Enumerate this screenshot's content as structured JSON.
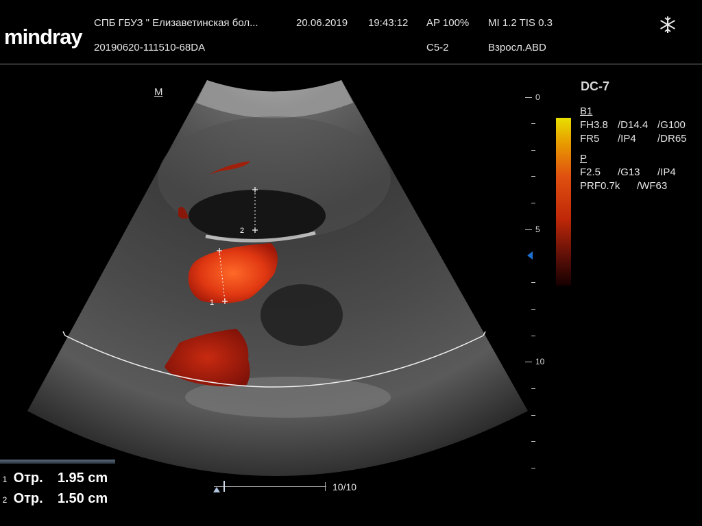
{
  "header": {
    "logo": "mindray",
    "institution": "СПБ  ГБУЗ \" Елизаветинская бол...",
    "date": "20.06.2019",
    "time": "19:43:12",
    "ap": "AP  100%",
    "mi_tis": "MI 1.2 TIS 0.3",
    "patient_id": "20190620-111510-68DA",
    "probe": "C5-2",
    "preset": "Взросл.ABD",
    "freeze_icon": "snowflake-icon"
  },
  "image": {
    "orientation_marker": "M",
    "page": "10/10"
  },
  "depth_scale": {
    "labels": [
      "0",
      "5",
      "10"
    ]
  },
  "params": {
    "system": "DC-7",
    "b_mode_title": "B1",
    "b_line1": [
      "FH3.8",
      "/D14.4",
      "/G100"
    ],
    "b_line2": [
      "FR5",
      "/IP4",
      "/DR65"
    ],
    "p_mode_title": "P",
    "p_line1": [
      "F2.5",
      "/G13",
      "/IP4"
    ],
    "p_line2": [
      "PRF0.7k",
      "/WF63"
    ]
  },
  "colors": {
    "doppler_top": "#e8e000",
    "doppler_mid": "#d03010",
    "doppler_bottom": "#200000",
    "focus_marker": "#1e70d0"
  },
  "measurements": [
    {
      "index": "1",
      "label": "Отр.",
      "value": "1.95 cm"
    },
    {
      "index": "2",
      "label": "Отр.",
      "value": "1.50 cm"
    }
  ],
  "calipers": [
    {
      "index": "1"
    },
    {
      "index": "2"
    }
  ]
}
